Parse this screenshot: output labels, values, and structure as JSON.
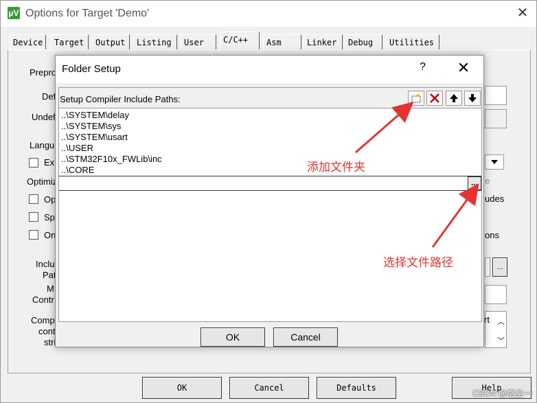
{
  "main": {
    "title": "Options for Target 'Demo'",
    "icon": "µV",
    "close": "✕",
    "tabs": [
      {
        "label": "Device"
      },
      {
        "label": "Target"
      },
      {
        "label": "Output"
      },
      {
        "label": "Listing"
      },
      {
        "label": "User"
      },
      {
        "label": "C/C++"
      },
      {
        "label": "Asm"
      },
      {
        "label": "Linker"
      },
      {
        "label": "Debug"
      },
      {
        "label": "Utilities"
      }
    ],
    "active_tab": "C/C++",
    "bg": {
      "preprocessor": "Prepro",
      "define": "Def",
      "undefine": "Undef",
      "language": "Langu",
      "ex": "Ex",
      "optimize": "Optimiz",
      "op": "Op",
      "sp": "Sp",
      "on": "On",
      "include_paths_1": "Inclu",
      "include_paths_2": "Pat",
      "misc_1": "M",
      "misc_2": "Contr",
      "compiler_1": "Comp",
      "compiler_2": "cont",
      "compiler_3": "stri",
      "right_e": "e",
      "right_udes": "udes",
      "right_ons": "ons",
      "right_rt": "rt",
      "browse": "..."
    },
    "buttons": {
      "ok": "OK",
      "cancel": "Cancel",
      "defaults": "Defaults",
      "help": "Help"
    }
  },
  "dialog": {
    "title": "Folder Setup",
    "help": "?",
    "close": "✕",
    "paths_label": "Setup Compiler Include Paths:",
    "paths": [
      "..\\SYSTEM\\delay",
      "..\\SYSTEM\\sys",
      "..\\SYSTEM\\usart",
      "..\\USER",
      "..\\STM32F10x_FWLib\\inc",
      "..\\CORE"
    ],
    "browse": "...",
    "ok": "OK",
    "cancel": "Cancel"
  },
  "annotations": {
    "add_folder": "添加文件夹",
    "choose_path": "选择文件路径",
    "color": "#e53333"
  },
  "watermark": "CSDN @烙尘~~"
}
